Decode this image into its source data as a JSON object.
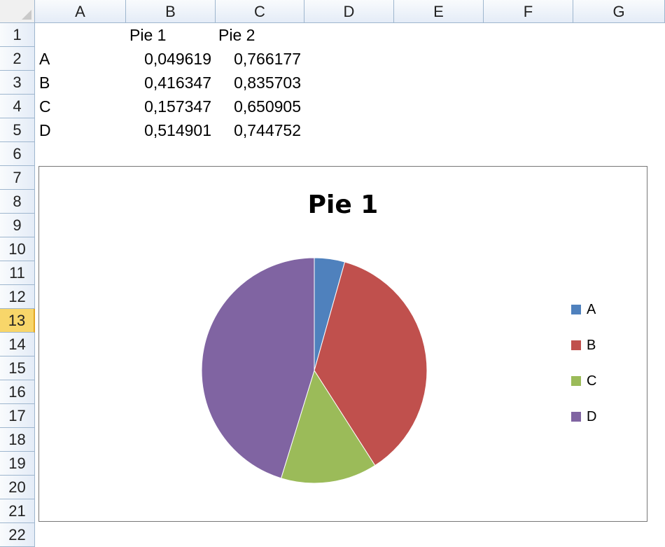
{
  "sheet": {
    "columns": [
      "A",
      "B",
      "C",
      "D",
      "E",
      "F",
      "G"
    ],
    "rows": [
      "1",
      "2",
      "3",
      "4",
      "5",
      "6",
      "7",
      "8",
      "9",
      "10",
      "11",
      "12",
      "13",
      "14",
      "15",
      "16",
      "17",
      "18",
      "19",
      "20",
      "21",
      "22"
    ],
    "active_row": "13",
    "header": {
      "b": "Pie 1",
      "c": "Pie 2"
    },
    "data_rows": [
      {
        "label": "A",
        "pie1": "0,049619",
        "pie2": "0,766177"
      },
      {
        "label": "B",
        "pie1": "0,416347",
        "pie2": "0,835703"
      },
      {
        "label": "C",
        "pie1": "0,157347",
        "pie2": "0,650905"
      },
      {
        "label": "D",
        "pie1": "0,514901",
        "pie2": "0,744752"
      }
    ]
  },
  "chart_data": {
    "type": "pie",
    "title": "Pie 1",
    "categories": [
      "A",
      "B",
      "C",
      "D"
    ],
    "values": [
      0.049619,
      0.416347,
      0.157347,
      0.514901
    ],
    "colors": [
      "#4f81bd",
      "#c0504d",
      "#9bbb59",
      "#8064a2"
    ],
    "legend_position": "right"
  }
}
